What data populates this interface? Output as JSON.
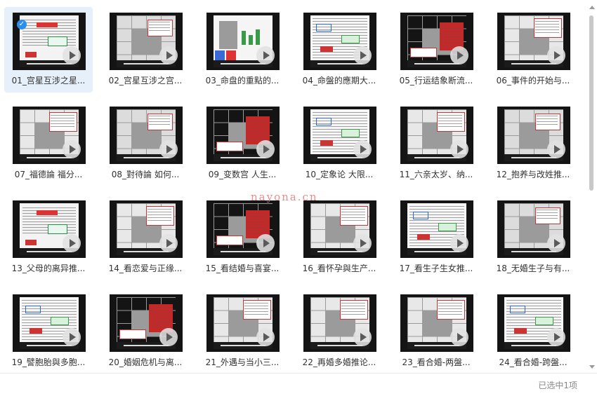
{
  "files": [
    {
      "label": "01_宫星互涉之星...",
      "selected": true,
      "variant": 0
    },
    {
      "label": "02_宫星互涉之宫...",
      "selected": false,
      "variant": 1
    },
    {
      "label": "03_命盘的重點的...",
      "selected": false,
      "variant": 2
    },
    {
      "label": "04_命盤的應期大...",
      "selected": false,
      "variant": 3
    },
    {
      "label": "05_行运结象断流...",
      "selected": false,
      "variant": 4
    },
    {
      "label": "06_事件的开始与...",
      "selected": false,
      "variant": 5
    },
    {
      "label": "07_福德論 福分...",
      "selected": false,
      "variant": 5
    },
    {
      "label": "08_對待論 如何...",
      "selected": false,
      "variant": 1
    },
    {
      "label": "09_变数宫 人生...",
      "selected": false,
      "variant": 4
    },
    {
      "label": "10_定象论 大限...",
      "selected": false,
      "variant": 3
    },
    {
      "label": "11_六亲太岁、纳...",
      "selected": false,
      "variant": 5
    },
    {
      "label": "12_抱养与改姓推...",
      "selected": false,
      "variant": 1
    },
    {
      "label": "13_父母的离异推...",
      "selected": false,
      "variant": 0
    },
    {
      "label": "14_看恋爱与正缘...",
      "selected": false,
      "variant": 5
    },
    {
      "label": "15_看结婚与喜宴...",
      "selected": false,
      "variant": 4
    },
    {
      "label": "16_看怀孕與生产...",
      "selected": false,
      "variant": 5
    },
    {
      "label": "17_看生子生女推...",
      "selected": false,
      "variant": 3
    },
    {
      "label": "18_无婚生子与有...",
      "selected": false,
      "variant": 1
    },
    {
      "label": "19_譬胞胎與多胞...",
      "selected": false,
      "variant": 3
    },
    {
      "label": "20_婚姻危机与离...",
      "selected": false,
      "variant": 4
    },
    {
      "label": "21_外遇与当小三...",
      "selected": false,
      "variant": 5
    },
    {
      "label": "22_再婚多婚推论...",
      "selected": false,
      "variant": 5
    },
    {
      "label": "23_看合婚-两盤...",
      "selected": false,
      "variant": 5
    },
    {
      "label": "24_看合婚-跨盤...",
      "selected": false,
      "variant": 3
    }
  ],
  "status": {
    "selection_text": "已选中1项"
  },
  "watermark": "nayona.cn",
  "icons": {
    "play": "play-icon",
    "check": "check-icon"
  },
  "colors": {
    "selection_bg": "#e6f0fb",
    "accent": "#2d8cf0",
    "watermark": "#e27b76"
  }
}
